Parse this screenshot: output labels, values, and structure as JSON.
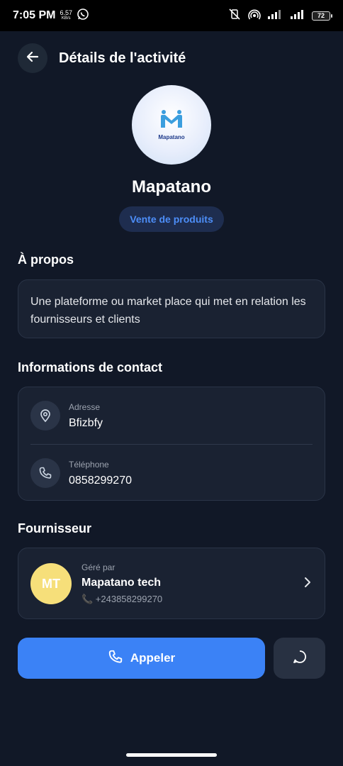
{
  "status_bar": {
    "time": "7:05 PM",
    "speed_value": "6.57",
    "speed_unit": "KB/s",
    "battery": "72"
  },
  "header": {
    "title": "Détails de l'activité"
  },
  "business": {
    "logo_text": "Mapatano",
    "name": "Mapatano",
    "category": "Vente de produits"
  },
  "about": {
    "title": "À propos",
    "text": "Une plateforme ou market place qui met en relation les  fournisseurs et clients"
  },
  "contact": {
    "title": "Informations de contact",
    "address_label": "Adresse",
    "address_value": "Bfizbfy",
    "phone_label": "Téléphone",
    "phone_value": "0858299270"
  },
  "supplier": {
    "title": "Fournisseur",
    "initials": "MT",
    "managed_by_label": "Géré par",
    "name": "Mapatano tech",
    "phone": "📞 +243858299270"
  },
  "actions": {
    "call_label": "Appeler"
  },
  "colors": {
    "background": "#111827",
    "card": "#1a2232",
    "accent": "#3b82f6",
    "chip_text": "#4d8ef8",
    "avatar": "#f6df7a"
  }
}
